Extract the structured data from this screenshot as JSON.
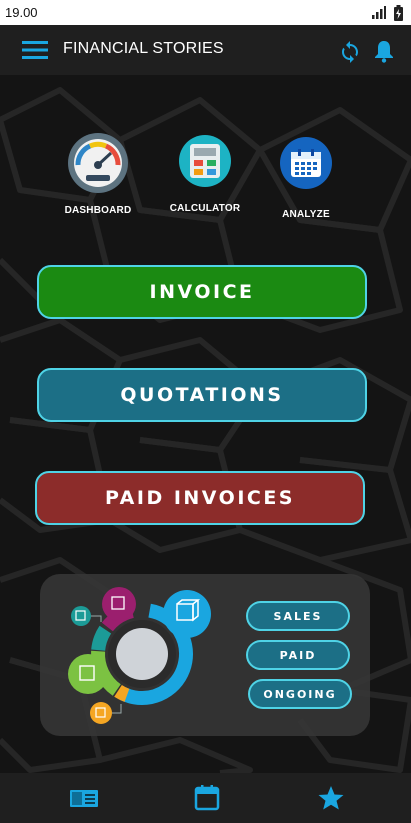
{
  "status_bar": {
    "time": "19.00"
  },
  "app_bar": {
    "title": "FINANCIAL STORIES"
  },
  "shortcuts": [
    {
      "label": "DASHBOARD",
      "icon": "speedometer-icon"
    },
    {
      "label": "CALCULATOR",
      "icon": "calculator-icon"
    },
    {
      "label": "ANALYZE",
      "icon": "calendar-icon"
    }
  ],
  "buttons": {
    "invoice": "INVOICE",
    "quotations": "QUOTATIONS",
    "paid_invoices": "PAID INVOICES"
  },
  "panel": {
    "sales": "SALES",
    "paid": "PAID",
    "ongoing": "ONGOING"
  },
  "bottom_nav": [
    "notes-icon",
    "calendar-icon",
    "star-icon"
  ],
  "colors": {
    "accent": "#1aa6e0",
    "invoice": "#1b8a12",
    "quotations": "#1c6f86",
    "paid_invoices": "#8c2c2a",
    "border": "#4fd3e6"
  }
}
